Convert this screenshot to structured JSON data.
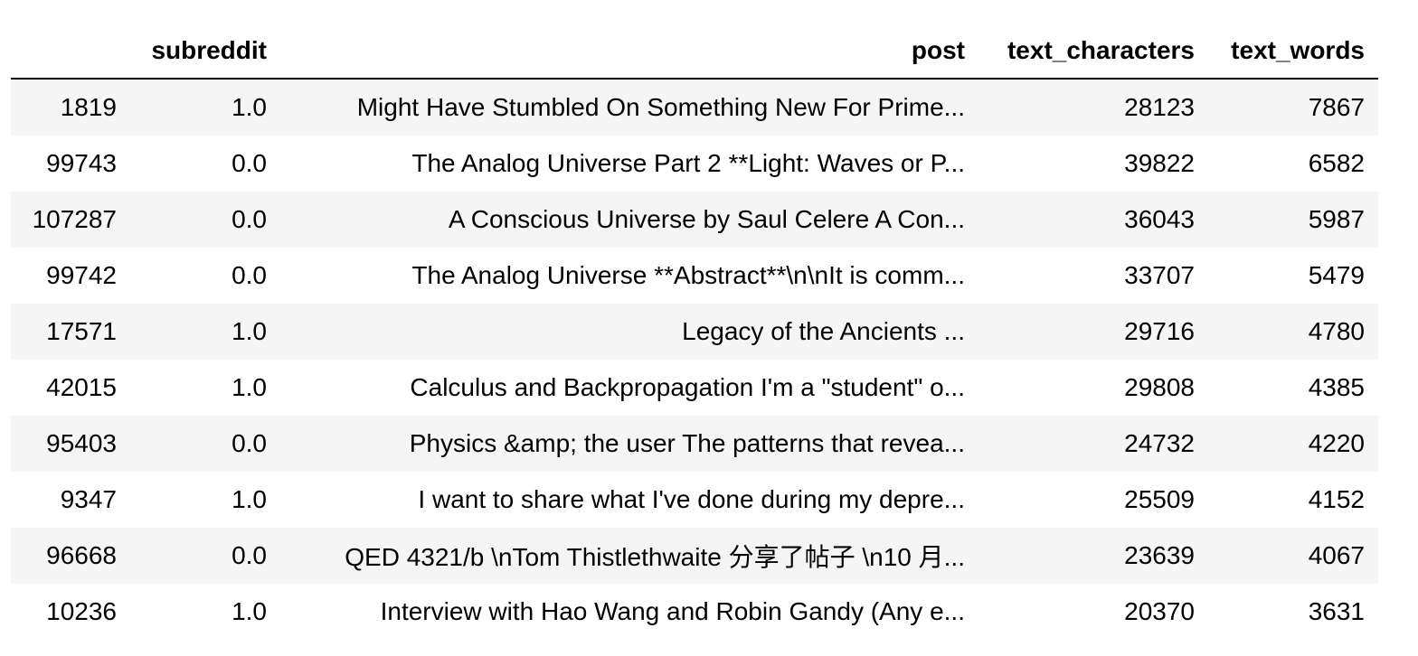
{
  "columns": {
    "index": "",
    "subreddit": "subreddit",
    "post": "post",
    "text_characters": "text_characters",
    "text_words": "text_words"
  },
  "rows": [
    {
      "index": "1819",
      "subreddit": "1.0",
      "post": "Might Have Stumbled On Something New For Prime...",
      "text_characters": "28123",
      "text_words": "7867"
    },
    {
      "index": "99743",
      "subreddit": "0.0",
      "post": "The Analog Universe Part 2 **Light: Waves or P...",
      "text_characters": "39822",
      "text_words": "6582"
    },
    {
      "index": "107287",
      "subreddit": "0.0",
      "post": "A Conscious Universe by Saul Celere A Con...",
      "text_characters": "36043",
      "text_words": "5987"
    },
    {
      "index": "99742",
      "subreddit": "0.0",
      "post": "The Analog Universe **Abstract**\\n\\nIt is comm...",
      "text_characters": "33707",
      "text_words": "5479"
    },
    {
      "index": "17571",
      "subreddit": "1.0",
      "post": "Legacy of the Ancients ...",
      "text_characters": "29716",
      "text_words": "4780"
    },
    {
      "index": "42015",
      "subreddit": "1.0",
      "post": "Calculus and Backpropagation I'm a \"student\" o...",
      "text_characters": "29808",
      "text_words": "4385"
    },
    {
      "index": "95403",
      "subreddit": "0.0",
      "post": "Physics &amp; the user The patterns that revea...",
      "text_characters": "24732",
      "text_words": "4220"
    },
    {
      "index": "9347",
      "subreddit": "1.0",
      "post": "I want to share what I've done during my depre...",
      "text_characters": "25509",
      "text_words": "4152"
    },
    {
      "index": "96668",
      "subreddit": "0.0",
      "post": "QED 4321/b \\nTom Thistlethwaite 分享了帖子 \\n10 月...",
      "text_characters": "23639",
      "text_words": "4067"
    },
    {
      "index": "10236",
      "subreddit": "1.0",
      "post": "Interview with Hao Wang and Robin Gandy (Any e...",
      "text_characters": "20370",
      "text_words": "3631"
    }
  ]
}
